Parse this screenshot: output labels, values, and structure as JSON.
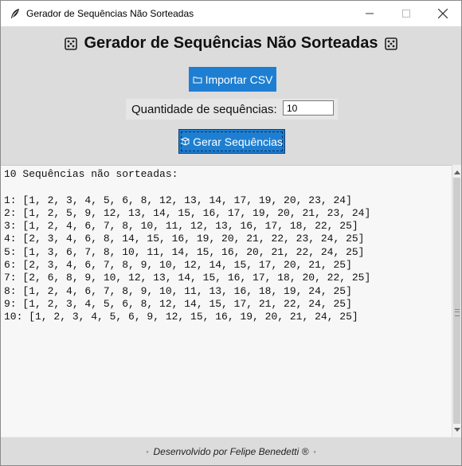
{
  "window": {
    "title": "Gerador de Sequências Não Sorteadas"
  },
  "header": {
    "title": "Gerador de Sequências Não Sorteadas"
  },
  "import_button": {
    "label": "Importar CSV"
  },
  "quantity": {
    "label": "Quantidade de sequências:",
    "value": "10"
  },
  "generate_button": {
    "label": "Gerar Sequências"
  },
  "output": {
    "heading": "10 Sequências não sorteadas:",
    "lines": [
      "1: [1, 2, 3, 4, 5, 6, 8, 12, 13, 14, 17, 19, 20, 23, 24]",
      "2: [1, 2, 5, 9, 12, 13, 14, 15, 16, 17, 19, 20, 21, 23, 24]",
      "3: [1, 2, 4, 6, 7, 8, 10, 11, 12, 13, 16, 17, 18, 22, 25]",
      "4: [2, 3, 4, 6, 8, 14, 15, 16, 19, 20, 21, 22, 23, 24, 25]",
      "5: [1, 3, 6, 7, 8, 10, 11, 14, 15, 16, 20, 21, 22, 24, 25]",
      "6: [2, 3, 4, 6, 7, 8, 9, 10, 12, 14, 15, 17, 20, 21, 25]",
      "7: [2, 6, 8, 9, 10, 12, 13, 14, 15, 16, 17, 18, 20, 22, 25]",
      "8: [1, 2, 4, 6, 7, 8, 9, 10, 11, 13, 16, 18, 19, 24, 25]",
      "9: [1, 2, 3, 4, 5, 6, 8, 12, 14, 15, 17, 21, 22, 24, 25]",
      "10: [1, 2, 3, 4, 5, 6, 9, 12, 15, 16, 19, 20, 21, 24, 25]"
    ]
  },
  "footer": {
    "text": "Desenvolvido por Felipe Benedetti ®"
  },
  "colors": {
    "accent": "#1e7fd2",
    "content_bg": "#dcdcdc",
    "output_bg": "#f7f7f7"
  },
  "icons": [
    "feather-icon",
    "die-icon",
    "folder-icon",
    "package-icon",
    "ring-icon"
  ]
}
